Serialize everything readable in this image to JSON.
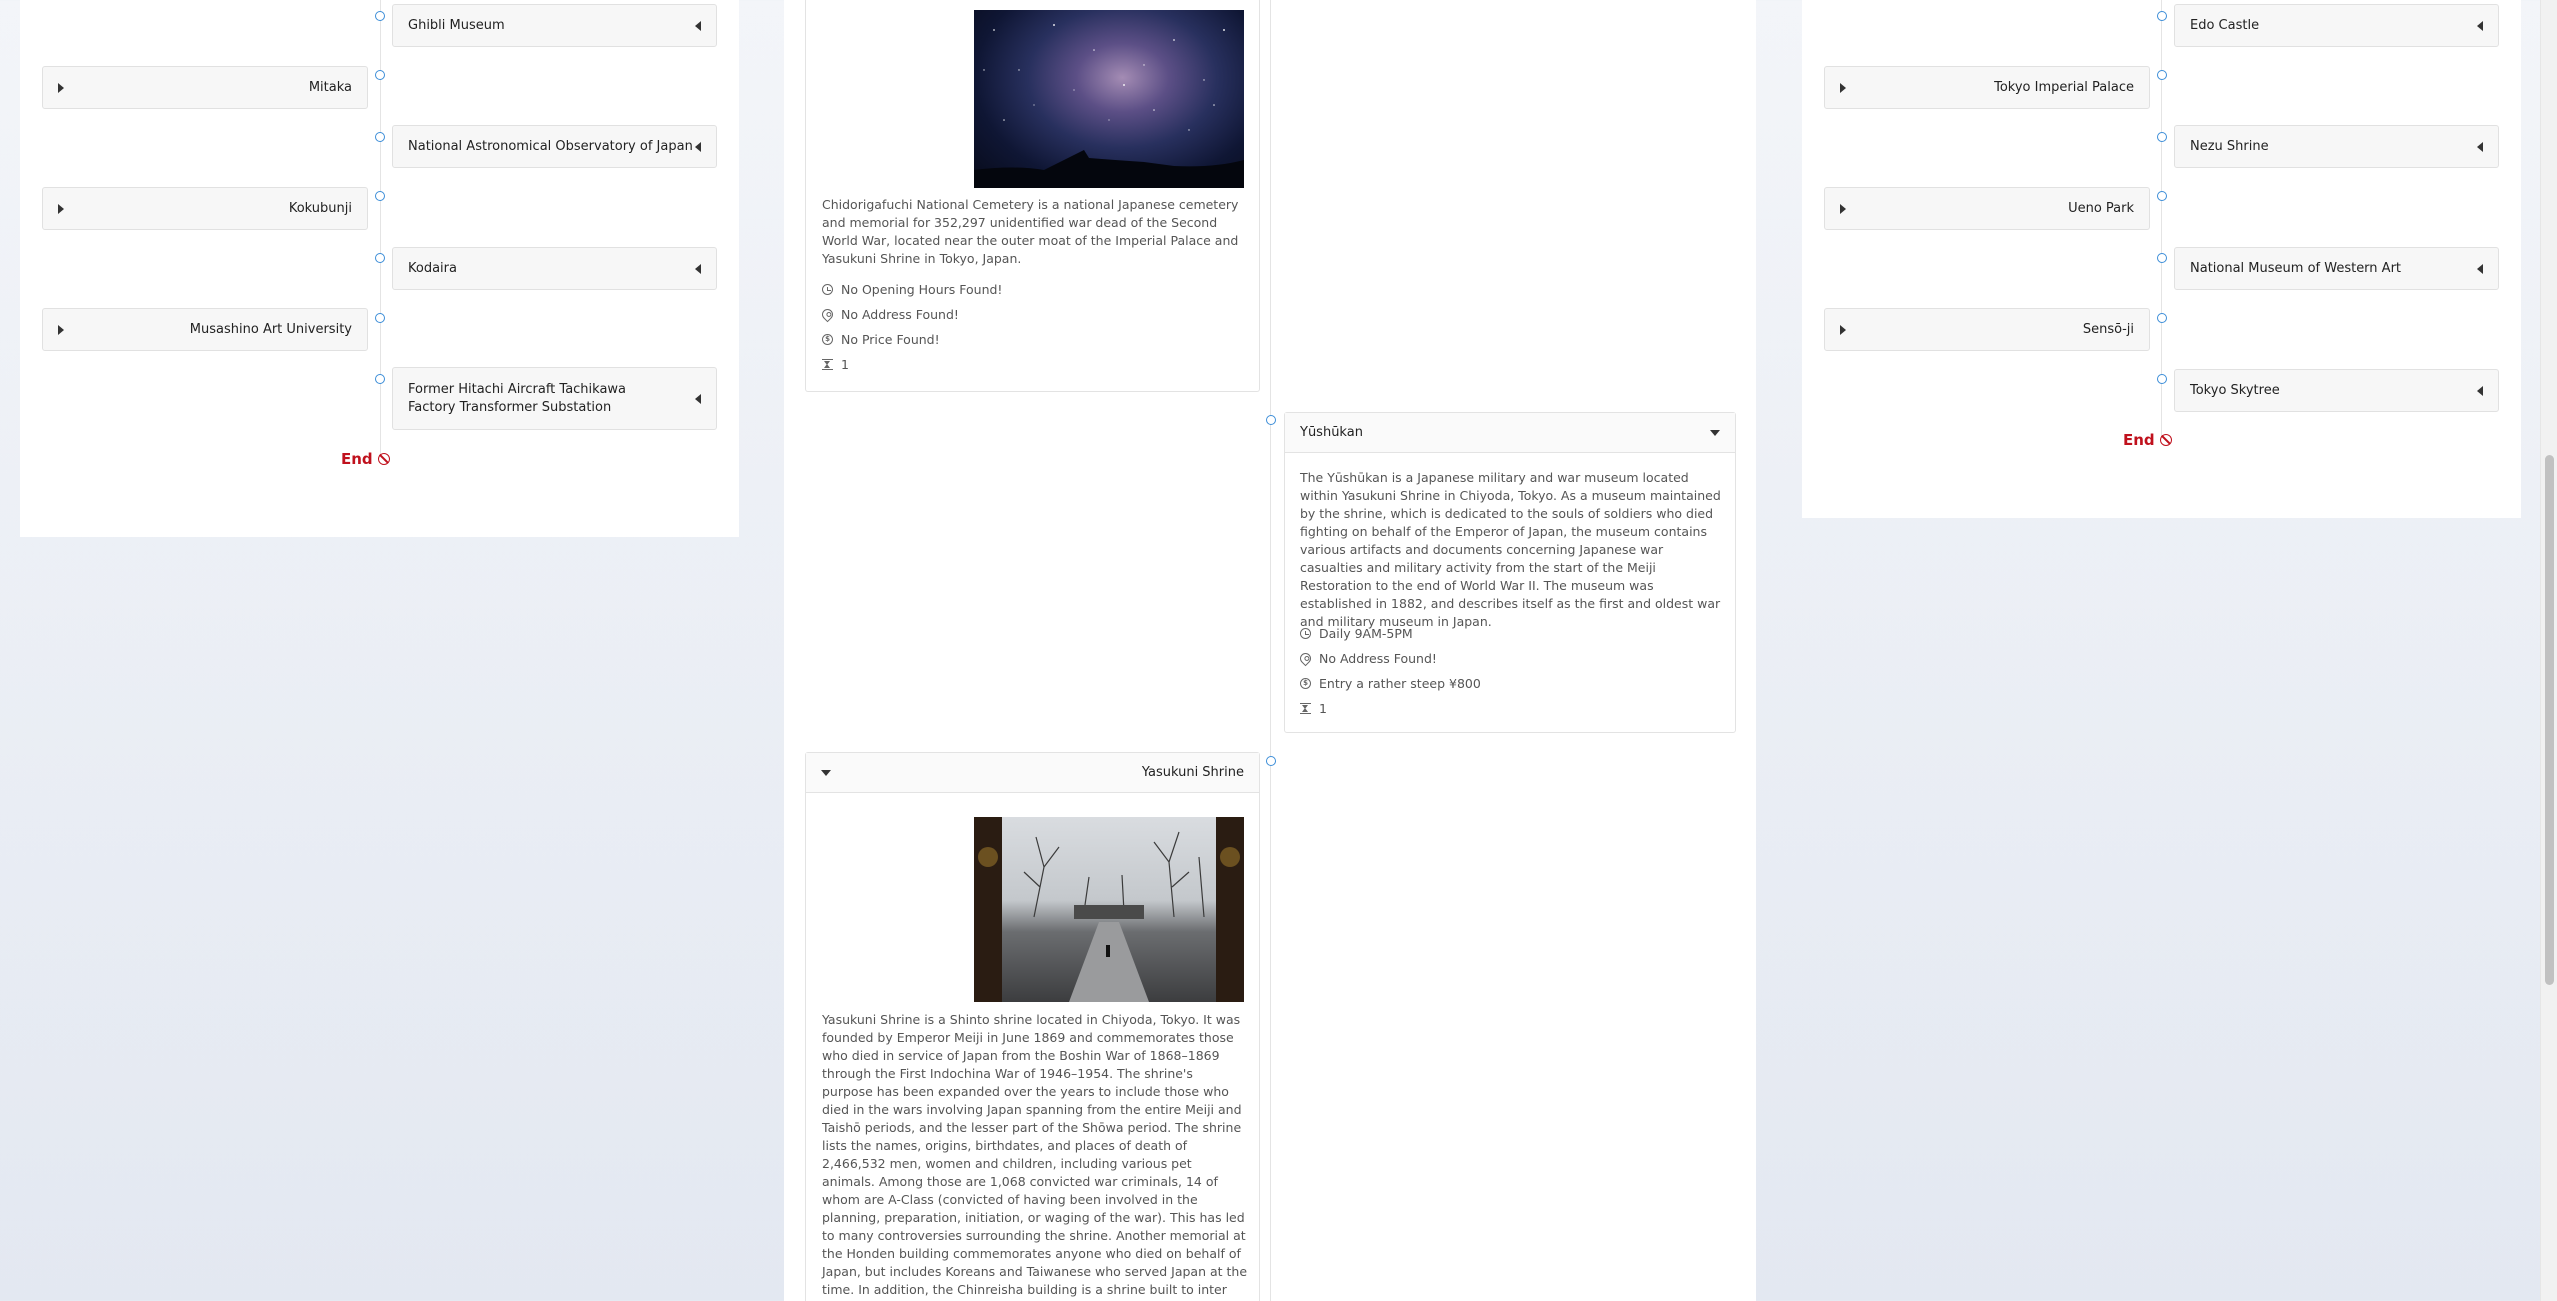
{
  "left_timeline": {
    "right_cards": [
      "Ghibli Museum",
      "National Astronomical Observatory of Japan",
      "Kodaira",
      "Former Hitachi Aircraft Tachikawa Factory Transformer Substation"
    ],
    "left_cards": [
      "Mitaka",
      "Kokubunji",
      "Musashino Art University"
    ],
    "end_label": "End"
  },
  "right_timeline": {
    "right_cards": [
      "Edo Castle",
      "Nezu Shrine",
      "National Museum of Western Art",
      "Tokyo Skytree"
    ],
    "left_cards": [
      "Tokyo Imperial Palace",
      "Ueno Park",
      "Sensō-ji"
    ],
    "end_label": "End"
  },
  "middle": {
    "chidori": {
      "description": "Chidorigafuchi National Cemetery is a national Japanese cemetery and memorial for 352,297 unidentified war dead of the Second World War, located near the outer moat of the Imperial Palace and Yasukuni Shrine in Tokyo, Japan.",
      "hours": "No Opening Hours Found!",
      "address": "No Address Found!",
      "price": "No Price Found!",
      "duration": "1"
    },
    "yushukan": {
      "title": "Yūshūkan",
      "description": "The Yūshūkan is a Japanese military and war museum located within Yasukuni Shrine in Chiyoda, Tokyo. As a museum maintained by the shrine, which is dedicated to the souls of soldiers who died fighting on behalf of the Emperor of Japan, the museum contains various artifacts and documents concerning Japanese war casualties and military activity from the start of the Meiji Restoration to the end of World War II. The museum was established in 1882, and describes itself as the first and oldest war and military museum in Japan.",
      "hours": "Daily 9AM-5PM",
      "address": "No Address Found!",
      "price": "Entry a rather steep ¥800",
      "duration": "1"
    },
    "yasukuni": {
      "title": "Yasukuni Shrine",
      "description": "Yasukuni Shrine is a Shinto shrine located in Chiyoda, Tokyo. It was founded by Emperor Meiji in June 1869 and commemorates those who died in service of Japan from the Boshin War of 1868–1869 through the First Indochina War of 1946–1954. The shrine's purpose has been expanded over the years to include those who died in the wars involving Japan spanning from the entire Meiji and Taishō periods, and the lesser part of the Shōwa period. The shrine lists the names, origins, birthdates, and places of death of 2,466,532 men, women and children, including various pet animals. Among those are 1,068 convicted war criminals, 14 of whom are A-Class (convicted of having been involved in the planning, preparation, initiation, or waging of the war). This has led to many controversies surrounding the shrine. Another memorial at the Honden building commemorates anyone who died on behalf of Japan, but includes Koreans and Taiwanese who served Japan at the time. In addition, the Chinreisha building is a shrine built to inter the souls of all the people who died"
    }
  },
  "colors": {
    "accent": "#3d8ed8",
    "end": "#c0111d"
  }
}
